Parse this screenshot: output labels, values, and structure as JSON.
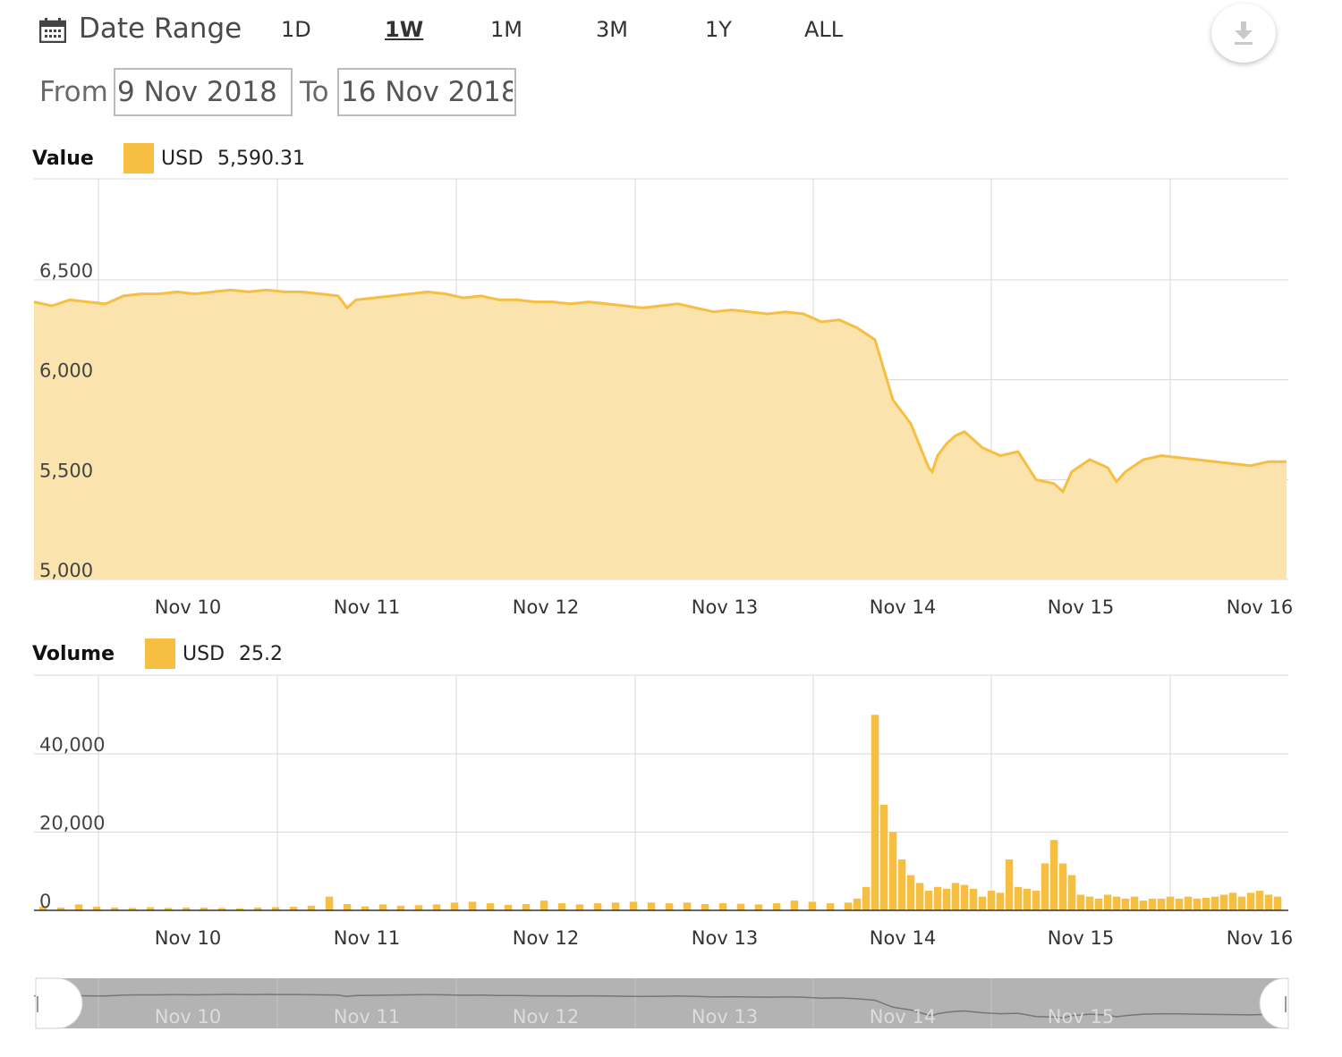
{
  "toolbar": {
    "date_range_label": "Date Range",
    "ranges": [
      "1D",
      "1W",
      "1M",
      "3M",
      "1Y",
      "ALL"
    ],
    "active_range": "1W",
    "from_label": "From",
    "from_value": "9 Nov 2018",
    "to_label": "To",
    "to_value": "16 Nov 2018"
  },
  "colors": {
    "accent": "#f7bf42",
    "fill": "#fae3ad",
    "grid": "#d8d8d8",
    "navigator": "#b3b3b3"
  },
  "icons": {
    "calendar": "calendar-icon",
    "download": "download-icon"
  },
  "chart_data": [
    {
      "type": "area",
      "title": "Value",
      "legend": {
        "currency": "USD",
        "value": "5,590.31"
      },
      "x_tick_labels": [
        "Nov 10",
        "Nov 11",
        "Nov 12",
        "Nov 13",
        "Nov 14",
        "Nov 15",
        "Nov 16"
      ],
      "y_tick_labels": [
        "5,000",
        "5,500",
        "6,000",
        "6,500"
      ],
      "y_ticks": [
        5000,
        5500,
        6000,
        6500
      ],
      "ylim": [
        5000,
        7000
      ],
      "xlim": [
        0,
        7
      ],
      "grid": true,
      "series": [
        {
          "x": [
            0,
            0.1,
            0.2,
            0.3,
            0.4,
            0.5,
            0.6,
            0.7,
            0.8,
            0.9,
            1,
            1.1,
            1.2,
            1.3,
            1.4,
            1.5,
            1.6,
            1.7,
            1.75,
            1.8,
            1.9,
            2,
            2.1,
            2.2,
            2.3,
            2.4,
            2.5,
            2.6,
            2.7,
            2.8,
            2.9,
            3,
            3.1,
            3.2,
            3.3,
            3.4,
            3.5,
            3.6,
            3.7,
            3.8,
            3.9,
            4,
            4.1,
            4.2,
            4.3,
            4.4,
            4.5,
            4.6,
            4.7,
            4.8,
            4.9,
            5,
            5.02,
            5.05,
            5.1,
            5.15,
            5.2,
            5.3,
            5.4,
            5.5,
            5.6,
            5.7,
            5.75,
            5.8,
            5.9,
            6,
            6.05,
            6.1,
            6.2,
            6.3,
            6.4,
            6.5,
            6.6,
            6.7,
            6.8,
            6.9,
            7
          ],
          "y": [
            6390,
            6370,
            6400,
            6390,
            6380,
            6420,
            6430,
            6430,
            6440,
            6430,
            6440,
            6450,
            6440,
            6450,
            6440,
            6440,
            6430,
            6420,
            6360,
            6400,
            6410,
            6420,
            6430,
            6440,
            6430,
            6410,
            6420,
            6400,
            6400,
            6390,
            6390,
            6380,
            6390,
            6380,
            6370,
            6360,
            6370,
            6380,
            6360,
            6340,
            6350,
            6340,
            6330,
            6340,
            6330,
            6290,
            6300,
            6260,
            6200,
            5900,
            5780,
            5560,
            5540,
            5620,
            5680,
            5720,
            5740,
            5660,
            5620,
            5640,
            5500,
            5480,
            5440,
            5540,
            5600,
            5560,
            5490,
            5540,
            5600,
            5620,
            5610,
            5600,
            5590,
            5580,
            5570,
            5590,
            5590
          ]
        }
      ]
    },
    {
      "type": "bar",
      "title": "Volume",
      "legend": {
        "currency": "USD",
        "value": "25.2"
      },
      "x_tick_labels": [
        "Nov 10",
        "Nov 11",
        "Nov 12",
        "Nov 13",
        "Nov 14",
        "Nov 15",
        "Nov 16"
      ],
      "y_tick_labels": [
        "0",
        "20,000",
        "40,000"
      ],
      "y_ticks": [
        0,
        20000,
        40000
      ],
      "ylim": [
        0,
        60000
      ],
      "xlim": [
        0,
        7
      ],
      "grid": true,
      "series": [
        {
          "x": [
            0.05,
            0.15,
            0.25,
            0.35,
            0.45,
            0.55,
            0.65,
            0.75,
            0.85,
            0.95,
            1.05,
            1.15,
            1.25,
            1.35,
            1.45,
            1.55,
            1.65,
            1.75,
            1.85,
            1.95,
            2.05,
            2.15,
            2.25,
            2.35,
            2.45,
            2.55,
            2.65,
            2.75,
            2.85,
            2.95,
            3.05,
            3.15,
            3.25,
            3.35,
            3.45,
            3.55,
            3.65,
            3.75,
            3.85,
            3.95,
            4.05,
            4.15,
            4.25,
            4.35,
            4.45,
            4.55,
            4.6,
            4.65,
            4.7,
            4.75,
            4.8,
            4.85,
            4.9,
            4.95,
            5.0,
            5.05,
            5.1,
            5.15,
            5.2,
            5.25,
            5.3,
            5.35,
            5.4,
            5.45,
            5.5,
            5.55,
            5.6,
            5.65,
            5.7,
            5.75,
            5.8,
            5.85,
            5.9,
            5.95,
            6.0,
            6.05,
            6.1,
            6.15,
            6.2,
            6.25,
            6.3,
            6.35,
            6.4,
            6.45,
            6.5,
            6.55,
            6.6,
            6.65,
            6.7,
            6.75,
            6.8,
            6.85,
            6.9,
            6.95
          ],
          "values": [
            900,
            700,
            1500,
            900,
            700,
            600,
            800,
            600,
            700,
            700,
            600,
            500,
            700,
            800,
            900,
            1200,
            3500,
            1600,
            1000,
            1500,
            1200,
            1300,
            1500,
            2000,
            2200,
            1800,
            1400,
            1600,
            2500,
            1800,
            1500,
            1800,
            2000,
            2200,
            2000,
            1800,
            2000,
            1600,
            1800,
            1700,
            1500,
            1800,
            2500,
            2200,
            1800,
            2000,
            3000,
            6000,
            50000,
            27000,
            20000,
            13000,
            9000,
            7000,
            5000,
            6000,
            5500,
            7000,
            6500,
            5500,
            3500,
            5000,
            4500,
            13000,
            6000,
            5500,
            5000,
            12000,
            18000,
            12000,
            9000,
            4000,
            3500,
            3000,
            4000,
            3500,
            3000,
            3500,
            2500,
            3000,
            3000,
            3500,
            3000,
            3500,
            3000,
            3200,
            3500,
            4000,
            4500,
            3500,
            4500,
            5000,
            4000,
            3500
          ]
        }
      ]
    },
    {
      "type": "area",
      "title": "",
      "x_tick_labels": [
        "Nov 10",
        "Nov 11",
        "Nov 12",
        "Nov 13",
        "Nov 14",
        "Nov 15"
      ],
      "xlim": [
        0,
        7
      ]
    }
  ]
}
